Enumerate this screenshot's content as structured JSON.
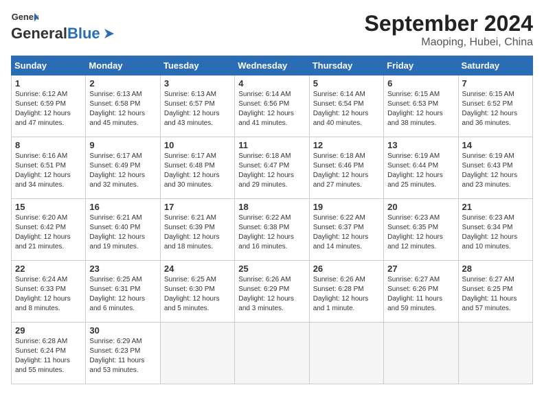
{
  "header": {
    "logo_text_general": "General",
    "logo_text_blue": "Blue",
    "month_title": "September 2024",
    "location": "Maoping, Hubei, China"
  },
  "weekdays": [
    "Sunday",
    "Monday",
    "Tuesday",
    "Wednesday",
    "Thursday",
    "Friday",
    "Saturday"
  ],
  "weeks": [
    [
      {
        "day": 1,
        "rise": "6:12 AM",
        "set": "6:59 PM",
        "daylight": "12 hours and 47 minutes."
      },
      {
        "day": 2,
        "rise": "6:13 AM",
        "set": "6:58 PM",
        "daylight": "12 hours and 45 minutes."
      },
      {
        "day": 3,
        "rise": "6:13 AM",
        "set": "6:57 PM",
        "daylight": "12 hours and 43 minutes."
      },
      {
        "day": 4,
        "rise": "6:14 AM",
        "set": "6:56 PM",
        "daylight": "12 hours and 41 minutes."
      },
      {
        "day": 5,
        "rise": "6:14 AM",
        "set": "6:54 PM",
        "daylight": "12 hours and 40 minutes."
      },
      {
        "day": 6,
        "rise": "6:15 AM",
        "set": "6:53 PM",
        "daylight": "12 hours and 38 minutes."
      },
      {
        "day": 7,
        "rise": "6:15 AM",
        "set": "6:52 PM",
        "daylight": "12 hours and 36 minutes."
      }
    ],
    [
      {
        "day": 8,
        "rise": "6:16 AM",
        "set": "6:51 PM",
        "daylight": "12 hours and 34 minutes."
      },
      {
        "day": 9,
        "rise": "6:17 AM",
        "set": "6:49 PM",
        "daylight": "12 hours and 32 minutes."
      },
      {
        "day": 10,
        "rise": "6:17 AM",
        "set": "6:48 PM",
        "daylight": "12 hours and 30 minutes."
      },
      {
        "day": 11,
        "rise": "6:18 AM",
        "set": "6:47 PM",
        "daylight": "12 hours and 29 minutes."
      },
      {
        "day": 12,
        "rise": "6:18 AM",
        "set": "6:46 PM",
        "daylight": "12 hours and 27 minutes."
      },
      {
        "day": 13,
        "rise": "6:19 AM",
        "set": "6:44 PM",
        "daylight": "12 hours and 25 minutes."
      },
      {
        "day": 14,
        "rise": "6:19 AM",
        "set": "6:43 PM",
        "daylight": "12 hours and 23 minutes."
      }
    ],
    [
      {
        "day": 15,
        "rise": "6:20 AM",
        "set": "6:42 PM",
        "daylight": "12 hours and 21 minutes."
      },
      {
        "day": 16,
        "rise": "6:21 AM",
        "set": "6:40 PM",
        "daylight": "12 hours and 19 minutes."
      },
      {
        "day": 17,
        "rise": "6:21 AM",
        "set": "6:39 PM",
        "daylight": "12 hours and 18 minutes."
      },
      {
        "day": 18,
        "rise": "6:22 AM",
        "set": "6:38 PM",
        "daylight": "12 hours and 16 minutes."
      },
      {
        "day": 19,
        "rise": "6:22 AM",
        "set": "6:37 PM",
        "daylight": "12 hours and 14 minutes."
      },
      {
        "day": 20,
        "rise": "6:23 AM",
        "set": "6:35 PM",
        "daylight": "12 hours and 12 minutes."
      },
      {
        "day": 21,
        "rise": "6:23 AM",
        "set": "6:34 PM",
        "daylight": "12 hours and 10 minutes."
      }
    ],
    [
      {
        "day": 22,
        "rise": "6:24 AM",
        "set": "6:33 PM",
        "daylight": "12 hours and 8 minutes."
      },
      {
        "day": 23,
        "rise": "6:25 AM",
        "set": "6:31 PM",
        "daylight": "12 hours and 6 minutes."
      },
      {
        "day": 24,
        "rise": "6:25 AM",
        "set": "6:30 PM",
        "daylight": "12 hours and 5 minutes."
      },
      {
        "day": 25,
        "rise": "6:26 AM",
        "set": "6:29 PM",
        "daylight": "12 hours and 3 minutes."
      },
      {
        "day": 26,
        "rise": "6:26 AM",
        "set": "6:28 PM",
        "daylight": "12 hours and 1 minute."
      },
      {
        "day": 27,
        "rise": "6:27 AM",
        "set": "6:26 PM",
        "daylight": "11 hours and 59 minutes."
      },
      {
        "day": 28,
        "rise": "6:27 AM",
        "set": "6:25 PM",
        "daylight": "11 hours and 57 minutes."
      }
    ],
    [
      {
        "day": 29,
        "rise": "6:28 AM",
        "set": "6:24 PM",
        "daylight": "11 hours and 55 minutes."
      },
      {
        "day": 30,
        "rise": "6:29 AM",
        "set": "6:23 PM",
        "daylight": "11 hours and 53 minutes."
      },
      null,
      null,
      null,
      null,
      null
    ]
  ]
}
